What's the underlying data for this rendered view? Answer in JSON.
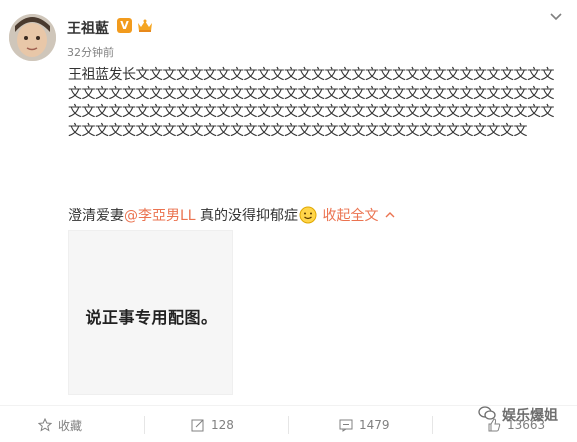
{
  "author": {
    "name": "王祖藍",
    "verified_badge": "V",
    "timestamp": "32分钟前"
  },
  "post": {
    "text": "王祖蓝发长文文文文文文文文文文文文文文文文文文文文文文文文文文文文文文文文文文文文文文文文文文文文文文文文文文文文文文文文文文文文文文文文文文文文文文文文文文文文文文文文文文文文文文文文文文文文文文文文文文文文文文文文文文文文文文文文文文文文文文文文文文文文文文文文文文文文文文文文文",
    "line2_prefix": "澄清爱妻",
    "mention": "@李亞男LL",
    "line2_suffix": " 真的没得抑郁症",
    "collapse_link": "收起全文",
    "image_caption": "说正事专用配图。"
  },
  "actions": {
    "favorite": "收藏",
    "repost_count": "128",
    "comment_count": "1479",
    "like_count": "13663"
  },
  "watermark": {
    "text": "娱乐爆姐"
  },
  "colors": {
    "accent": "#eb7350",
    "verified": "#f29b1d"
  }
}
